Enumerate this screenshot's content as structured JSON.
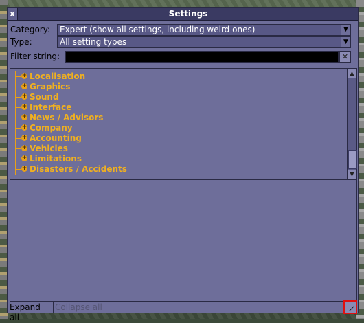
{
  "window": {
    "title": "Settings",
    "close_glyph": "x"
  },
  "category": {
    "label": "Category:",
    "value": "Expert (show all settings, including weird ones)"
  },
  "type": {
    "label": "Type:",
    "value": "All setting types"
  },
  "filter": {
    "label": "Filter string:",
    "value": "",
    "clear_glyph": "✕"
  },
  "tree": {
    "items": [
      {
        "label": "Localisation"
      },
      {
        "label": "Graphics"
      },
      {
        "label": "Sound"
      },
      {
        "label": "Interface"
      },
      {
        "label": "News / Advisors"
      },
      {
        "label": "Company"
      },
      {
        "label": "Accounting"
      },
      {
        "label": "Vehicles"
      },
      {
        "label": "Limitations"
      },
      {
        "label": "Disasters / Accidents"
      }
    ]
  },
  "buttons": {
    "expand_all": "Expand all",
    "collapse_all": "Collapse all"
  },
  "icons": {
    "close": "close-icon",
    "dropdown": "chevron-down-icon",
    "expand": "plus-circle-icon",
    "resize": "resize-grip-icon"
  }
}
